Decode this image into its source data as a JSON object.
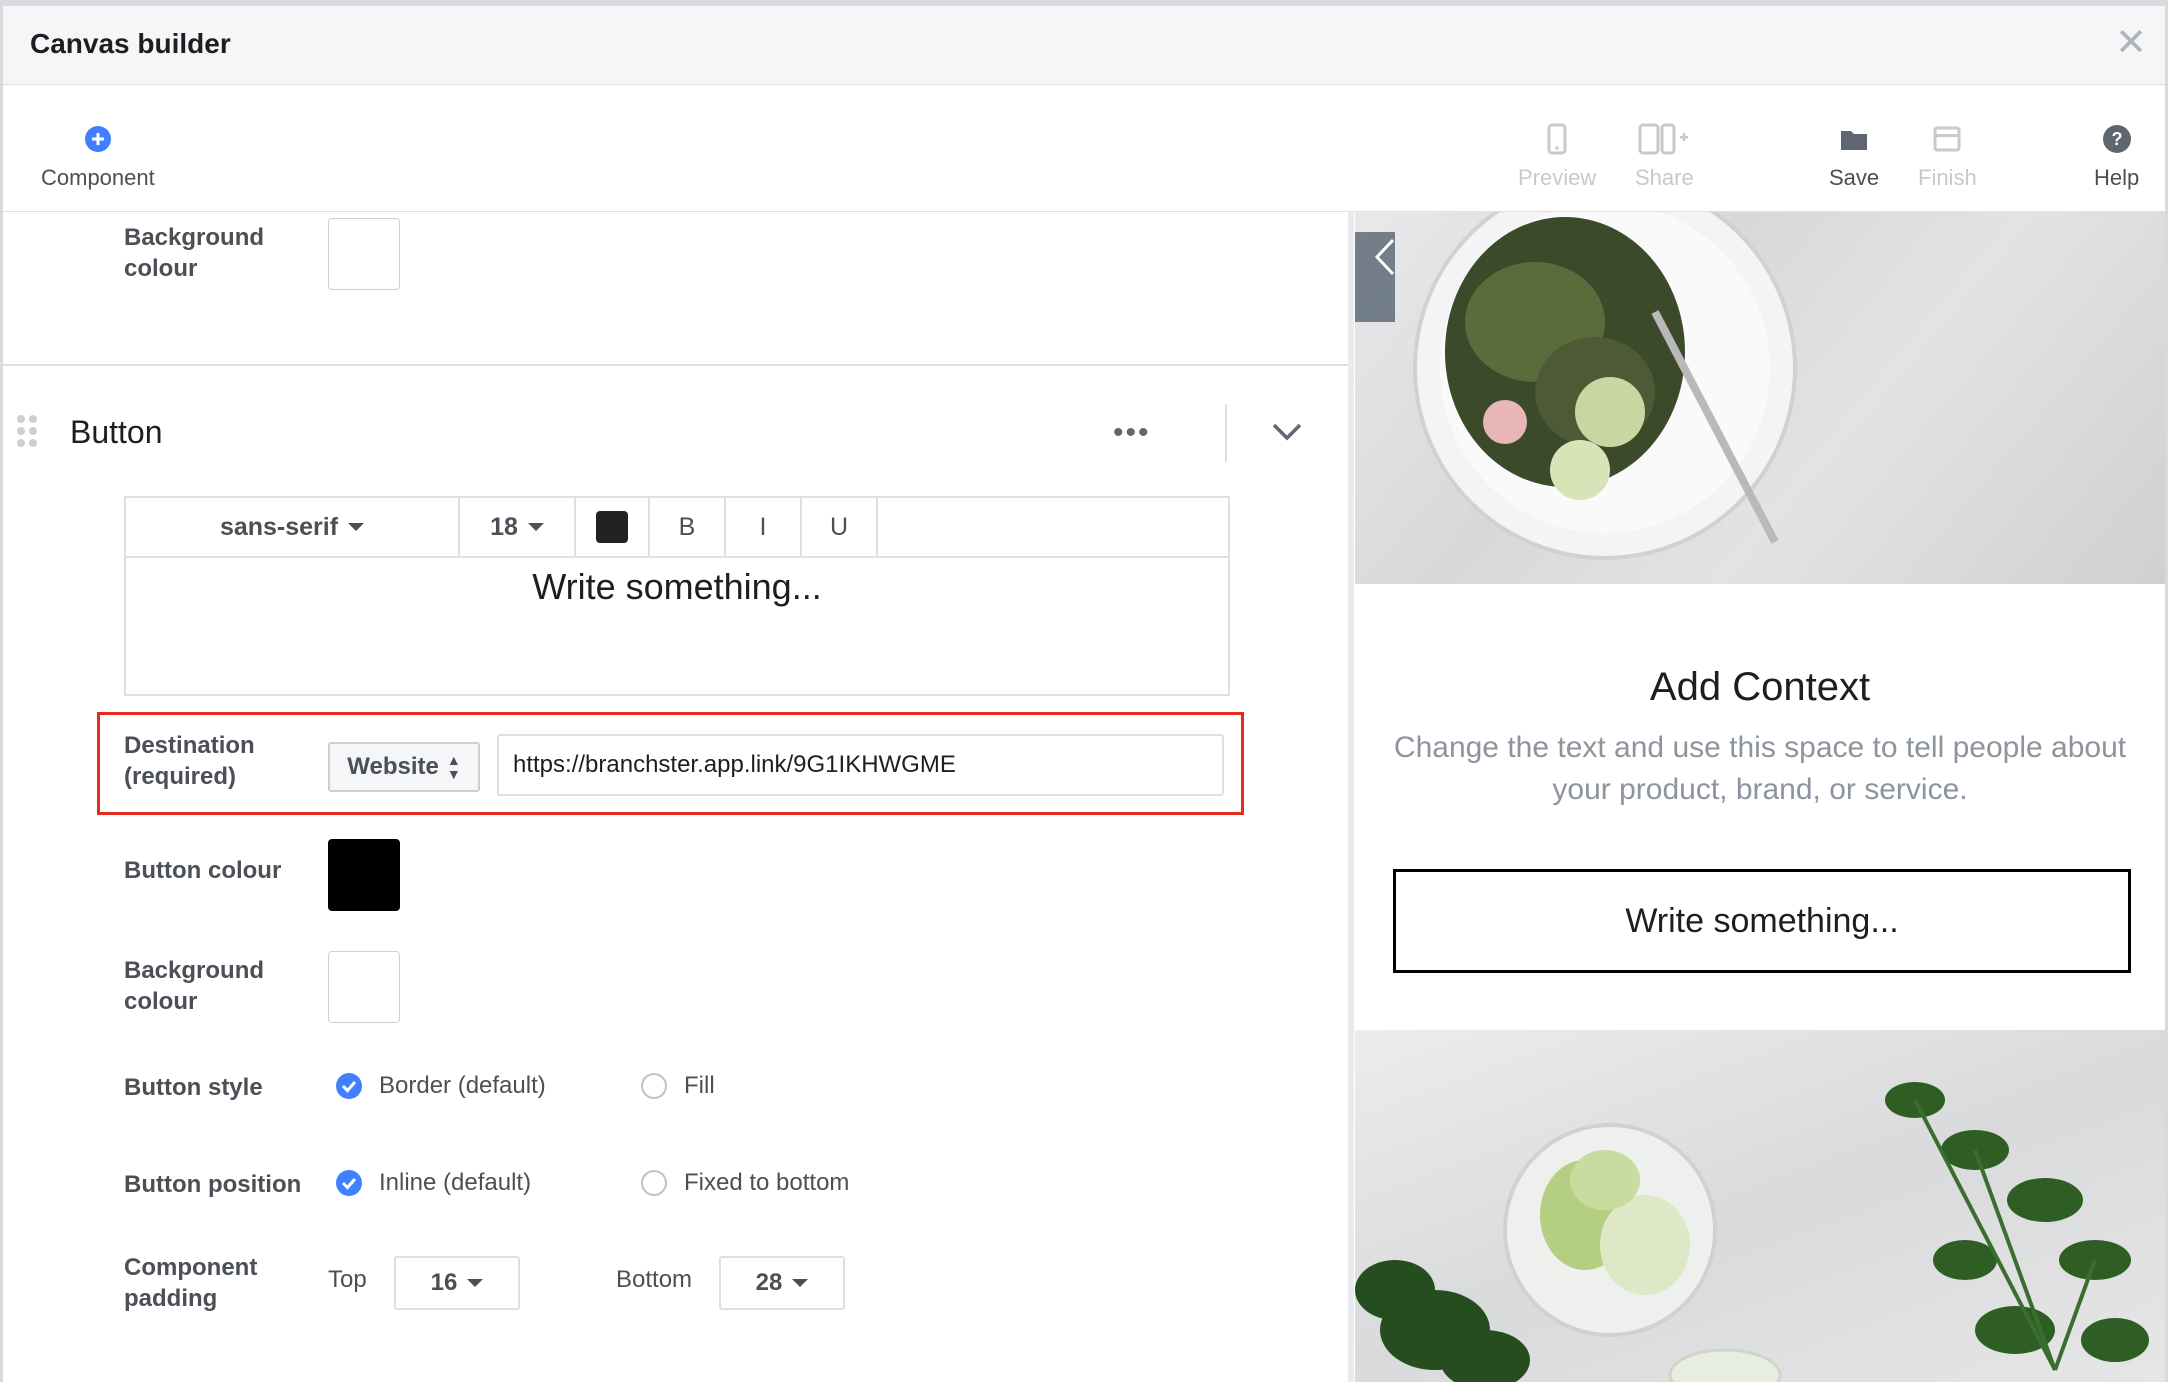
{
  "window": {
    "title": "Canvas builder"
  },
  "toolbar": {
    "component": "Component",
    "preview": "Preview",
    "share": "Share",
    "save": "Save",
    "finish": "Finish",
    "help": "Help"
  },
  "editor": {
    "top_background_label": "Background colour",
    "section_title": "Button",
    "rte": {
      "font": "sans-serif",
      "size": "18",
      "text_color": "#222222",
      "bold": "B",
      "italic": "I",
      "underline": "U",
      "content": "Write something..."
    },
    "destination": {
      "label": "Destination (required)",
      "type": "Website",
      "url": "https://branchster.app.link/9G1IKHWGME"
    },
    "button_colour": {
      "label": "Button colour",
      "value": "#000000"
    },
    "background_colour": {
      "label": "Background colour",
      "value": "#ffffff"
    },
    "button_style": {
      "label": "Button style",
      "options": [
        "Border (default)",
        "Fill"
      ],
      "selected": "Border (default)"
    },
    "button_position": {
      "label": "Button position",
      "options": [
        "Inline (default)",
        "Fixed to bottom"
      ],
      "selected": "Inline (default)"
    },
    "padding": {
      "label": "Component padding",
      "top_label": "Top",
      "top": "16",
      "bottom_label": "Bottom",
      "bottom": "28"
    }
  },
  "preview": {
    "heading": "Add Context",
    "body": "Change the text and use this space to tell people about your product, brand, or service.",
    "button_text": "Write something..."
  },
  "colors": {
    "accent": "#4080ff",
    "highlight": "#e62b1e"
  }
}
